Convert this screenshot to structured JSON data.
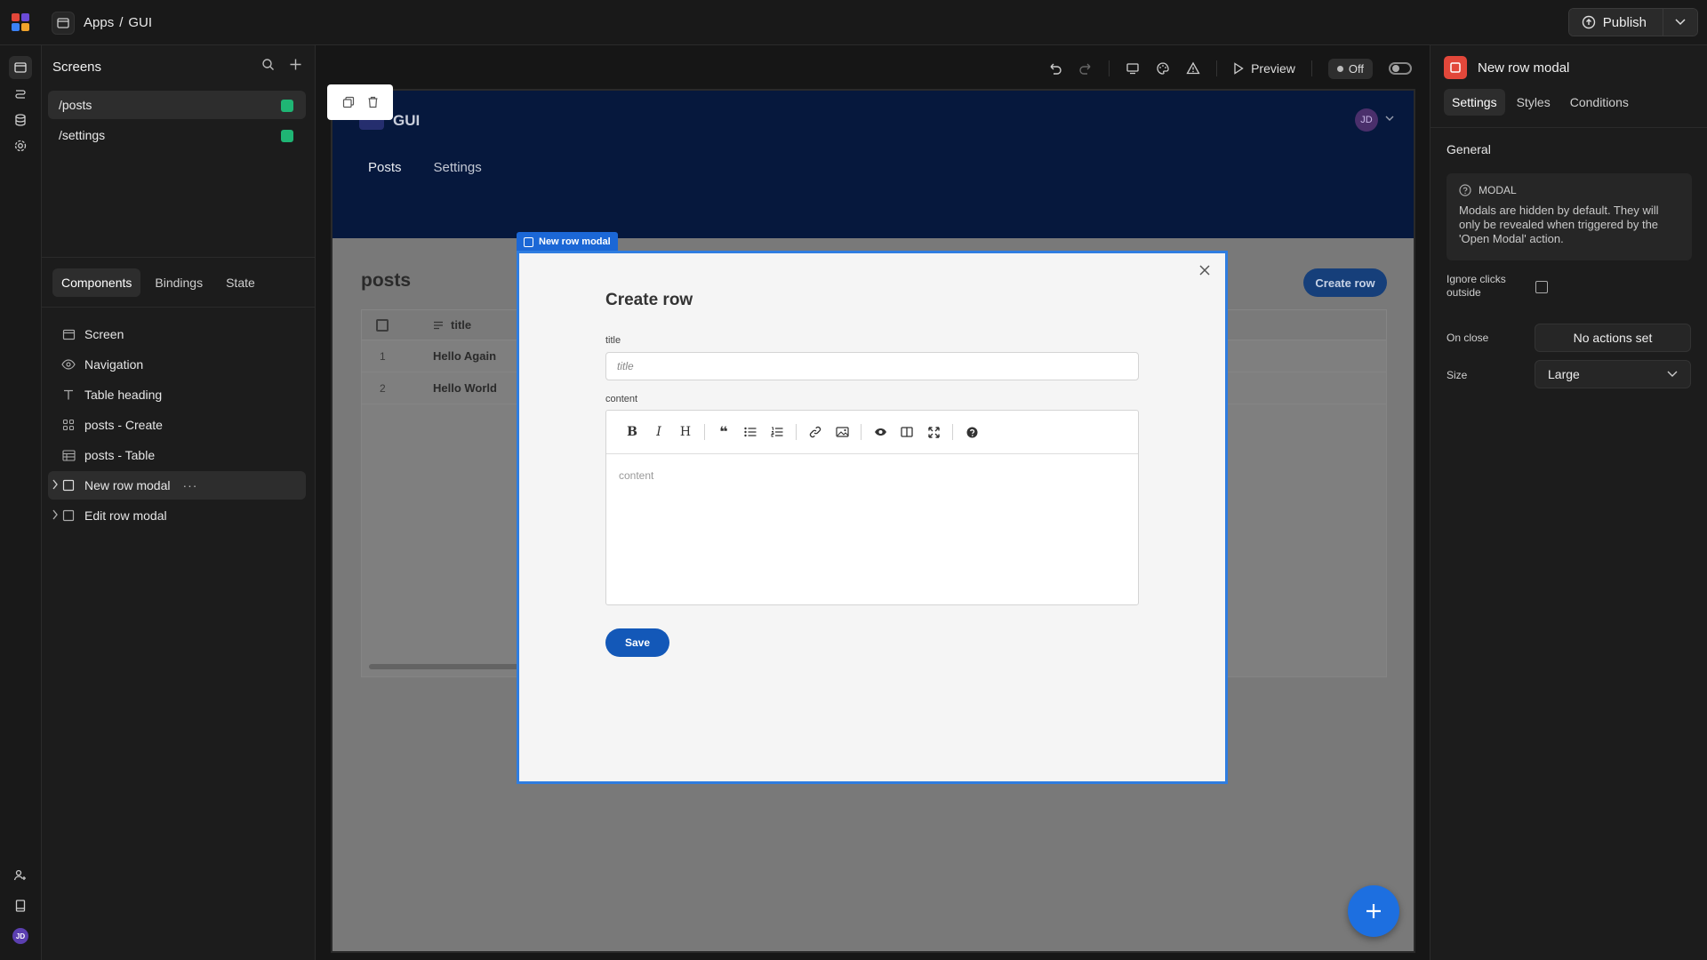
{
  "topbar": {
    "breadcrumb_apps": "Apps",
    "breadcrumb_sep": "/",
    "breadcrumb_app": "GUI",
    "publish_label": "Publish"
  },
  "screens": {
    "title": "Screens",
    "items": [
      {
        "route": "/posts",
        "selected": true
      },
      {
        "route": "/settings",
        "selected": false
      }
    ]
  },
  "left_tabs": [
    "Components",
    "Bindings",
    "State"
  ],
  "components": [
    {
      "label": "Screen",
      "icon": "screen-icon"
    },
    {
      "label": "Navigation",
      "icon": "eye-icon"
    },
    {
      "label": "Table heading",
      "icon": "text-icon"
    },
    {
      "label": "posts - Create",
      "icon": "form-icon"
    },
    {
      "label": "posts - Table",
      "icon": "table-icon"
    },
    {
      "label": "New row modal",
      "icon": "modal-icon",
      "selected": true,
      "more": "···"
    },
    {
      "label": "Edit row modal",
      "icon": "modal-icon"
    }
  ],
  "canvas_toolbar": {
    "preview_label": "Preview",
    "off_label": "Off"
  },
  "app_preview": {
    "nav_title": "GUI",
    "avatar": "JD",
    "links": [
      "Posts",
      "Settings"
    ],
    "page_title": "posts",
    "create_row_label": "Create row",
    "table": {
      "column": "title",
      "rows": [
        {
          "num": "1",
          "title": "Hello Again"
        },
        {
          "num": "2",
          "title": "Hello World"
        }
      ]
    }
  },
  "modal": {
    "tag": "New row modal",
    "title": "Create row",
    "title_label": "title",
    "title_placeholder": "title",
    "content_label": "content",
    "content_placeholder": "content",
    "save_label": "Save"
  },
  "right_panel": {
    "component_name": "New row modal",
    "tabs": [
      "Settings",
      "Styles",
      "Conditions"
    ],
    "section": "General",
    "info_title": "MODAL",
    "info_text": "Modals are hidden by default. They will only be revealed when triggered by the 'Open Modal' action.",
    "ignore_clicks_label_1": "Ignore clicks",
    "ignore_clicks_label_2": "outside",
    "on_close_label": "On close",
    "on_close_value": "No actions set",
    "size_label": "Size",
    "size_value": "Large"
  },
  "rail_avatar": "JD",
  "colors": {
    "accent_blue": "#2f7de0",
    "status_green": "#1fb574",
    "app_header": "#06183d",
    "modal_icon_red": "#e2473a"
  }
}
